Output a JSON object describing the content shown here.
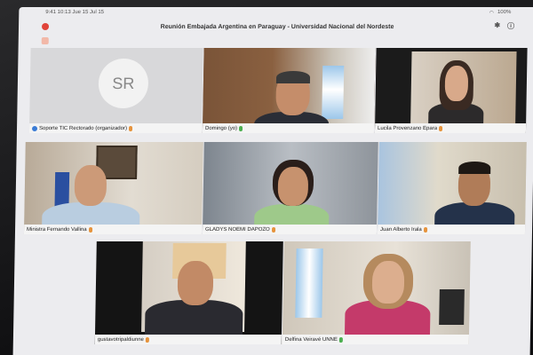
{
  "status_bar": {
    "left": "9:41  10:13  Jue 15 Jul  15",
    "right": "100%"
  },
  "window": {
    "title": "Reunión Embajada Argentina en Paraguay - Universidad Nacional del Nordeste"
  },
  "participants": [
    {
      "initials": "SR",
      "name": "Soporte TIC Rectorado (organizador)"
    },
    {
      "name": "Domingo (yo)"
    },
    {
      "name": "Lucila Provenzano Epara"
    },
    {
      "name": "Ministra Fernando Vallina"
    },
    {
      "name": "GLADYS NOEMI DAPOZO"
    },
    {
      "name": "Juan Alberto Irala"
    },
    {
      "name": "gustavotripaldiunne"
    },
    {
      "name": "Delfina Veiravé UNNE"
    }
  ]
}
